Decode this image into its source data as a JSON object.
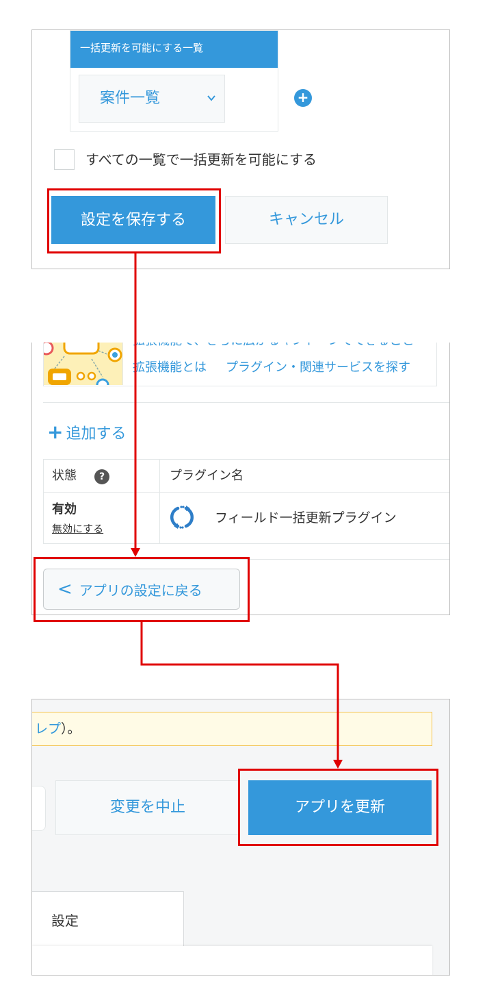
{
  "panel1": {
    "list_header": "一括更新を可能にする一覧",
    "selected_view": "案件一覧",
    "add_icon": "plus-circle-icon",
    "checkbox_label": "すべての一覧で一括更新を可能にする",
    "save_label": "設定を保存する",
    "cancel_label": "キャンセル"
  },
  "panel2": {
    "banner_cutoff_text": "拡張機能で、さらに広がるキントーンでできること",
    "link_what": "拡張機能とは",
    "link_search": "プラグイン・関連サービスを探す",
    "add_label": "追加する",
    "table": {
      "col_state": "状態",
      "col_plugin": "プラグイン名",
      "row": {
        "state": "有効",
        "disable_link": "無効にする",
        "plugin_name": "フィールド一括更新プラグイン"
      }
    },
    "back_label": "アプリの設定に戻る"
  },
  "panel3": {
    "notice_link_fragment": "レプ",
    "notice_tail": "）。",
    "abort_label": "変更を中止",
    "update_label": "アプリを更新",
    "tab_label": "設定"
  },
  "colors": {
    "accent": "#3498db",
    "highlight": "#e00000",
    "notice_border": "#f2c14e"
  }
}
